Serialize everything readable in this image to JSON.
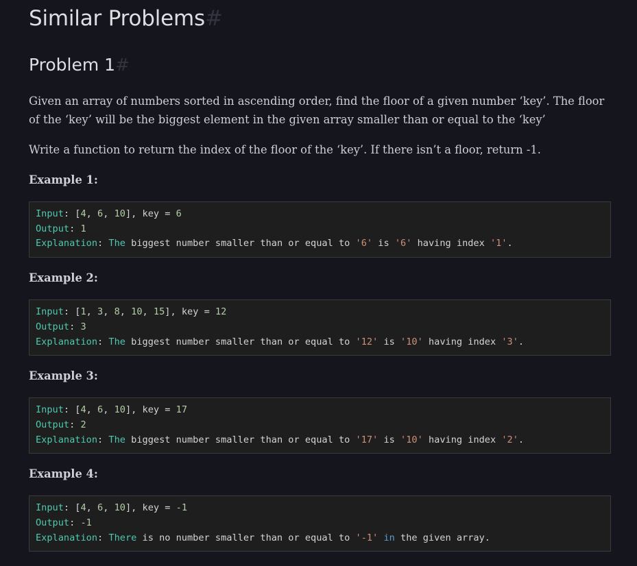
{
  "heading": {
    "title": "Similar Problems",
    "anchor": "#"
  },
  "problem": {
    "title": "Problem 1",
    "anchor": "#"
  },
  "description": [
    "Given an array of numbers sorted in ascending order, find the floor of a given number ‘key’. The floor of the ‘key’ will be the biggest element in the given array smaller than or equal to the ‘key’",
    "Write a function to return the index of the floor of the ‘key’. If there isn’t a floor, return -1."
  ],
  "examples": [
    {
      "heading": "Example 1:",
      "lines": [
        [
          {
            "t": "Input",
            "c": "key"
          },
          {
            "t": ": ["
          },
          {
            "t": "4",
            "c": "num"
          },
          {
            "t": ", "
          },
          {
            "t": "6",
            "c": "num"
          },
          {
            "t": ", "
          },
          {
            "t": "10",
            "c": "num"
          },
          {
            "t": "], key = "
          },
          {
            "t": "6",
            "c": "num"
          }
        ],
        [
          {
            "t": "Output",
            "c": "key"
          },
          {
            "t": ": "
          },
          {
            "t": "1",
            "c": "num"
          }
        ],
        [
          {
            "t": "Explanation",
            "c": "key"
          },
          {
            "t": ": "
          },
          {
            "t": "The",
            "c": "key"
          },
          {
            "t": " biggest number smaller than or equal to "
          },
          {
            "t": "'6'",
            "c": "str"
          },
          {
            "t": " is "
          },
          {
            "t": "'6'",
            "c": "str"
          },
          {
            "t": " having index "
          },
          {
            "t": "'1'",
            "c": "str"
          },
          {
            "t": "."
          }
        ]
      ]
    },
    {
      "heading": "Example 2:",
      "lines": [
        [
          {
            "t": "Input",
            "c": "key"
          },
          {
            "t": ": ["
          },
          {
            "t": "1",
            "c": "num"
          },
          {
            "t": ", "
          },
          {
            "t": "3",
            "c": "num"
          },
          {
            "t": ", "
          },
          {
            "t": "8",
            "c": "num"
          },
          {
            "t": ", "
          },
          {
            "t": "10",
            "c": "num"
          },
          {
            "t": ", "
          },
          {
            "t": "15",
            "c": "num"
          },
          {
            "t": "], key = "
          },
          {
            "t": "12",
            "c": "num"
          }
        ],
        [
          {
            "t": "Output",
            "c": "key"
          },
          {
            "t": ": "
          },
          {
            "t": "3",
            "c": "num"
          }
        ],
        [
          {
            "t": "Explanation",
            "c": "key"
          },
          {
            "t": ": "
          },
          {
            "t": "The",
            "c": "key"
          },
          {
            "t": " biggest number smaller than or equal to "
          },
          {
            "t": "'12'",
            "c": "str"
          },
          {
            "t": " is "
          },
          {
            "t": "'10'",
            "c": "str"
          },
          {
            "t": " having index "
          },
          {
            "t": "'3'",
            "c": "str"
          },
          {
            "t": "."
          }
        ]
      ]
    },
    {
      "heading": "Example 3:",
      "lines": [
        [
          {
            "t": "Input",
            "c": "key"
          },
          {
            "t": ": ["
          },
          {
            "t": "4",
            "c": "num"
          },
          {
            "t": ", "
          },
          {
            "t": "6",
            "c": "num"
          },
          {
            "t": ", "
          },
          {
            "t": "10",
            "c": "num"
          },
          {
            "t": "], key = "
          },
          {
            "t": "17",
            "c": "num"
          }
        ],
        [
          {
            "t": "Output",
            "c": "key"
          },
          {
            "t": ": "
          },
          {
            "t": "2",
            "c": "num"
          }
        ],
        [
          {
            "t": "Explanation",
            "c": "key"
          },
          {
            "t": ": "
          },
          {
            "t": "The",
            "c": "key"
          },
          {
            "t": " biggest number smaller than or equal to "
          },
          {
            "t": "'17'",
            "c": "str"
          },
          {
            "t": " is "
          },
          {
            "t": "'10'",
            "c": "str"
          },
          {
            "t": " having index "
          },
          {
            "t": "'2'",
            "c": "str"
          },
          {
            "t": "."
          }
        ]
      ]
    },
    {
      "heading": "Example 4:",
      "lines": [
        [
          {
            "t": "Input",
            "c": "key"
          },
          {
            "t": ": ["
          },
          {
            "t": "4",
            "c": "num"
          },
          {
            "t": ", "
          },
          {
            "t": "6",
            "c": "num"
          },
          {
            "t": ", "
          },
          {
            "t": "10",
            "c": "num"
          },
          {
            "t": "], key = "
          },
          {
            "t": "-1",
            "c": "num"
          }
        ],
        [
          {
            "t": "Output",
            "c": "key"
          },
          {
            "t": ": "
          },
          {
            "t": "-1",
            "c": "num"
          }
        ],
        [
          {
            "t": "Explanation",
            "c": "key"
          },
          {
            "t": ": "
          },
          {
            "t": "There",
            "c": "key"
          },
          {
            "t": " is no number smaller than or equal to "
          },
          {
            "t": "'-1'",
            "c": "str"
          },
          {
            "t": " "
          },
          {
            "t": "in",
            "c": "kw"
          },
          {
            "t": " the given array."
          }
        ]
      ]
    }
  ],
  "colors": {
    "background": "#15151d",
    "code_background": "#1e1e1e",
    "identifier": "#4ec9b0",
    "number": "#b5cea8",
    "string": "#ce9178",
    "keyword": "#569cd6"
  }
}
